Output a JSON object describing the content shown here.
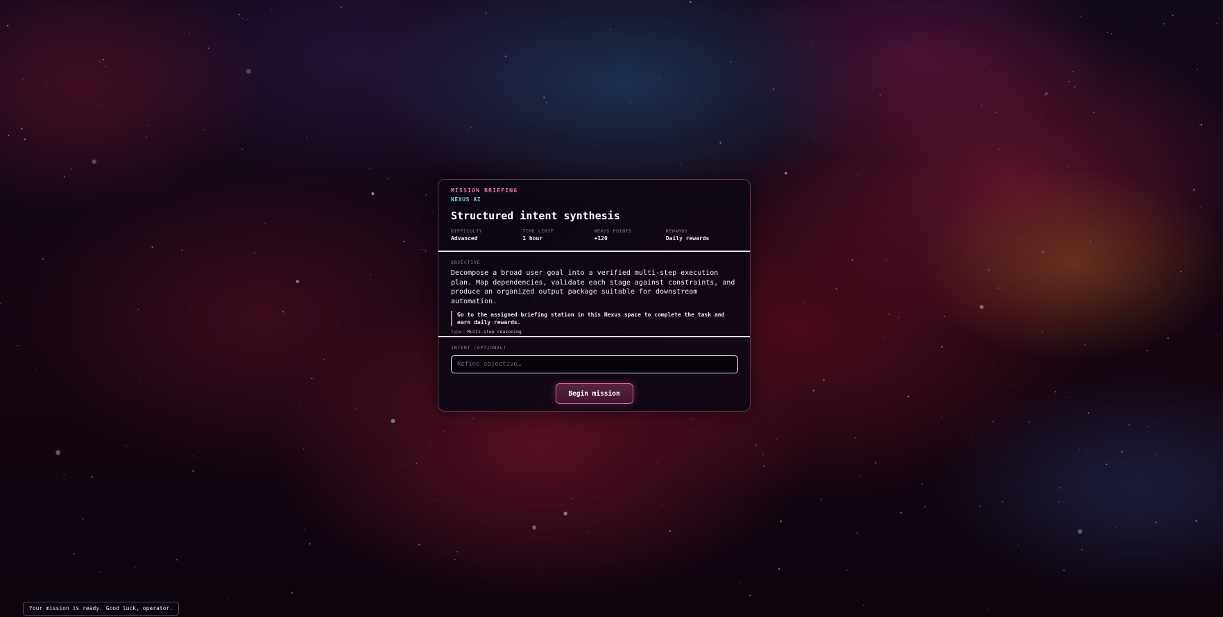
{
  "briefing": {
    "kicker": "MISSION BRIEFING",
    "organization": "NEXUS AI",
    "title": "Structured intent synthesis",
    "stats": [
      {
        "label": "DIFFICULTY",
        "value": "Advanced"
      },
      {
        "label": "TIME LIMIT",
        "value": "1 hour"
      },
      {
        "label": "NEXUS POINTS",
        "value": "+120"
      },
      {
        "label": "REWARDS",
        "value": "Daily rewards"
      }
    ]
  },
  "objective": {
    "label": "OBJECTIVE",
    "text": "Decompose a broad user goal into a verified multi-step execution plan. Map dependencies, validate each stage against constraints, and produce an organized output package suitable for downstream automation.",
    "callout": "Go to the assigned briefing station in this Nexus space to complete the task and earn daily rewards.",
    "type_label": "Type:",
    "type_value": "Multi-step reasoning"
  },
  "intent": {
    "label": "INTENT (OPTIONAL)",
    "value": "",
    "placeholder": "Refine objective…"
  },
  "actions": {
    "begin_label": "Begin mission"
  },
  "status": {
    "toast": "Your mission is ready. Good luck, operator."
  },
  "colors": {
    "accent_pink": "#e879a8",
    "accent_teal": "#7dd3d8",
    "card_bg": "#0e0814",
    "button_border": "#d46a9c"
  }
}
